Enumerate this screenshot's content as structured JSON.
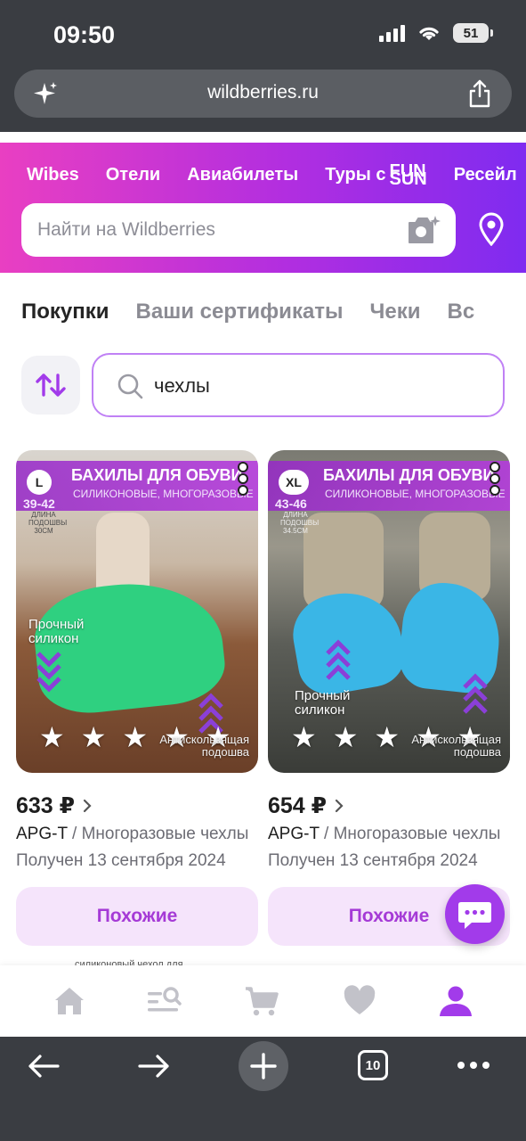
{
  "status": {
    "time": "09:50",
    "battery": "51"
  },
  "browser": {
    "url": "wildberries.ru",
    "tabs_count": "10"
  },
  "header": {
    "nav": [
      "Wibes",
      "Отели",
      "Авиабилеты",
      "Туры с",
      "Ресейл"
    ],
    "funsun": [
      "FUN",
      "SUN"
    ],
    "search_placeholder": "Найти на Wildberries"
  },
  "tabs": [
    "Покупки",
    "Ваши сертификаты",
    "Чеки",
    "Вс"
  ],
  "filter": {
    "query": "чехлы"
  },
  "products": [
    {
      "size": "L",
      "size_range": "39-42",
      "sole_length": [
        "ДЛИНА",
        "ПОДОШВЫ",
        "30СМ"
      ],
      "banner_title": "БАХИЛЫ ДЛЯ ОБУВИ",
      "banner_sub": "СИЛИКОНОВЫЕ, МНОГОРАЗОВЫЕ",
      "strong_label": [
        "Прочный",
        "силикон"
      ],
      "anti_label": [
        "Антискользящая",
        "подошва"
      ],
      "price": "633 ₽",
      "brand": "APG-T",
      "name": "Многоразовые чехлы",
      "received": "Получен 13 сентября 2024",
      "similar": "Похожие",
      "accent": "#2fd080"
    },
    {
      "size": "XL",
      "size_range": "43-46",
      "sole_length": [
        "ДЛИНА",
        "ПОДОШВЫ",
        "34.5СМ"
      ],
      "banner_title": "БАХИЛЫ ДЛЯ ОБУВИ",
      "banner_sub": "СИЛИКОНОВЫЕ, МНОГОРАЗОВЫЕ",
      "strong_label": [
        "Прочный",
        "силикон"
      ],
      "anti_label": [
        "Антискользящая",
        "подошва"
      ],
      "price": "654 ₽",
      "brand": "APG-T",
      "name": "Многоразовые чехлы",
      "received": "Получен 13 сентября 2024",
      "similar": "Похожие",
      "accent": "#3ab6e6"
    }
  ],
  "peek_text": "силиконовый чехол для",
  "bottom_nav": [
    "home-icon",
    "catalog-search-icon",
    "cart-icon",
    "heart-icon",
    "profile-icon"
  ],
  "colors": {
    "brand_purple": "#a23bea",
    "active_tab": "#a53ad6"
  }
}
